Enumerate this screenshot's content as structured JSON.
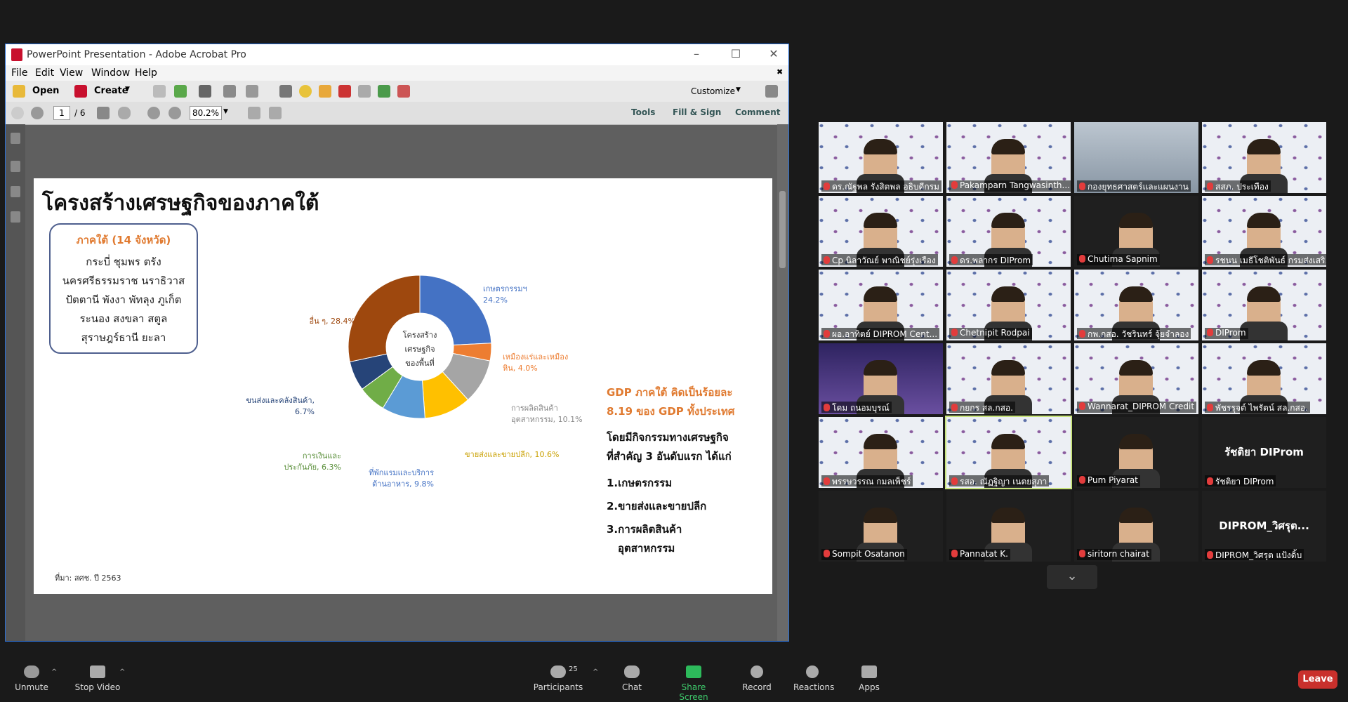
{
  "acrobat": {
    "title": "PowerPoint Presentation - Adobe Acrobat Pro",
    "menu": [
      "File",
      "Edit",
      "View",
      "Window",
      "Help"
    ],
    "toolbar": {
      "open": "Open",
      "create": "Create",
      "customize": "Customize"
    },
    "nav": {
      "page_current": "1",
      "page_total": "/ 6",
      "zoom": "80.2%"
    },
    "panels": {
      "tools": "Tools",
      "fill_sign": "Fill & Sign",
      "comment": "Comment"
    }
  },
  "slide": {
    "title": "โครงสร้างเศรษฐกิจของภาคใต้",
    "region_heading": "ภาคใต้ (14 จังหวัด)",
    "region_lines": [
      "กระบี่ ชุมพร ตรัง",
      "นครศรีธรรมราช นราธิวาส",
      "ปัตตานี พังงา พัทลุง ภูเก็ต",
      "ระนอง สงขลา สตูล",
      "สุราษฎร์ธานี ยะลา"
    ],
    "donut_center": [
      "โครงสร้าง",
      "เศรษฐกิจ",
      "ของพื้นที่"
    ],
    "source": "ที่มา: สศช. ปี 2563",
    "gdp_heading": [
      "GDP ภาคใต้ คิดเป็นร้อยละ",
      "8.19 ของ GDP ทั้งประเทศ"
    ],
    "gdp_body": [
      "โดยมีกิจกรรมทางเศรษฐกิจ",
      "ที่สำคัญ 3 อันดับแรก ได้แก่"
    ],
    "ranks": [
      "1.เกษตรกรรม",
      "2.ขายส่งและขายปลีก",
      "3.การผลิตสินค้า",
      "อุตสาหกรรม"
    ]
  },
  "chart_data": {
    "type": "pie",
    "donut": true,
    "categories": [
      "เกษตรกรรมฯ",
      "เหมืองแร่และเหมืองหิน",
      "การผลิตสินค้าอุตสาหกรรม",
      "ขายส่งและขายปลีก",
      "ที่พักแรมและบริการด้านอาหาร",
      "การเงินและประกันภัย",
      "ขนส่งและคลังสินค้า",
      "อื่น ๆ"
    ],
    "values": [
      24.2,
      4.0,
      10.1,
      10.6,
      9.8,
      6.3,
      6.7,
      28.4
    ],
    "labels": [
      [
        "เกษตรกรรมฯ",
        "24.2%"
      ],
      [
        "เหมืองแร่และเหมือง",
        "หิน, 4.0%"
      ],
      [
        "การผลิตสินค้า",
        "อุตสาหกรรม, 10.1%"
      ],
      [
        "ขายส่งและขายปลีก, 10.6%"
      ],
      [
        "ที่พักแรมและบริการ",
        "ด้านอาหาร, 9.8%"
      ],
      [
        "การเงินและ",
        "ประกันภัย, 6.3%"
      ],
      [
        "ขนส่งและคลังสินค้า,",
        "6.7%"
      ],
      [
        "อื่น ๆ, 28.4%"
      ]
    ],
    "colors": [
      "#4472c4",
      "#ed7d31",
      "#a5a5a5",
      "#ffc000",
      "#5b9bd5",
      "#70ad47",
      "#264478",
      "#9e480e"
    ]
  },
  "participants": [
    {
      "name": "ดร.ณัฐพล รังสิตพล อธิบดีกรม",
      "bg": "pattern",
      "person": true
    },
    {
      "name": "Pakamparn Tangwasinth...",
      "bg": "pattern",
      "person": true
    },
    {
      "name": "กองยุทธศาสตร์และแผนงาน",
      "bg": "office",
      "person": false
    },
    {
      "name": "สสภ. ประเทือง",
      "bg": "pattern",
      "person": true
    },
    {
      "name": "Cp นิลาวัณย์ พาณิชย์รุ่งเรือง",
      "bg": "pattern",
      "person": true
    },
    {
      "name": "ดร.พลากร DIProm",
      "bg": "pattern",
      "person": true
    },
    {
      "name": "Chutima Sapnim",
      "bg": "black",
      "person": true
    },
    {
      "name": "รชนน เมธีโชติพันธ์ กรมส่งเสริ...",
      "bg": "pattern",
      "person": true
    },
    {
      "name": "ผอ.อาทิตย์ DIPROM Cent...",
      "bg": "pattern",
      "person": true
    },
    {
      "name": "Chetnipit Rodpai",
      "bg": "pattern",
      "person": true
    },
    {
      "name": "กพ.กสอ. วัชรินทร์ จุ้ยจำลอง",
      "bg": "pattern",
      "person": true
    },
    {
      "name": "DIProm",
      "bg": "pattern",
      "person": true
    },
    {
      "name": "โดม ถนอมบุรณ์",
      "bg": "purple",
      "person": true
    },
    {
      "name": "กยกร สล.กสอ.",
      "bg": "pattern",
      "person": true
    },
    {
      "name": "Wannarat_DIPROM Credit",
      "bg": "pattern",
      "person": true
    },
    {
      "name": "พัชรรุจต์ ไพรัตน์ สล.กสอ.",
      "bg": "pattern",
      "person": true
    },
    {
      "name": "พรรษวรรณ กมลเพ็ชร์",
      "bg": "pattern",
      "person": true
    },
    {
      "name": "รสอ. ณัฏฐิญา เนตยสุภา",
      "bg": "pattern",
      "person": true,
      "active": true
    },
    {
      "name": "Pum Piyarat",
      "bg": "black",
      "person": true
    },
    {
      "name": "รัชติยา DIProm",
      "bg": "black",
      "person": false,
      "big": "รัชติยา DIProm"
    },
    {
      "name": "Sompit Osatanon",
      "bg": "black",
      "person": true
    },
    {
      "name": "Pannatat K.",
      "bg": "black",
      "person": true
    },
    {
      "name": "siritorn chairat",
      "bg": "black",
      "person": true
    },
    {
      "name": "DIPROM_วิศรุต แป้งดิ้บ",
      "bg": "black",
      "person": false,
      "big": "DIPROM_วิศรุต..."
    }
  ],
  "zoom_bar": {
    "unmute": "Unmute",
    "stop_video": "Stop Video",
    "participants": "Participants",
    "participants_count": "25",
    "chat": "Chat",
    "share_screen": "Share Screen",
    "record": "Record",
    "reactions": "Reactions",
    "apps": "Apps",
    "leave": "Leave"
  }
}
